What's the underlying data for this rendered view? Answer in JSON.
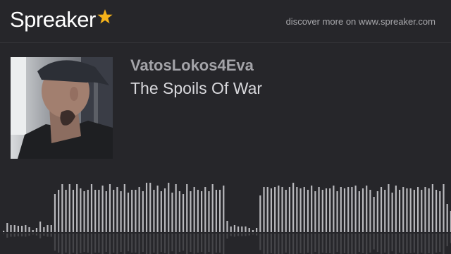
{
  "header": {
    "logo_text": "Spreaker",
    "logo_star_color": "#f5b21a",
    "discover_text": "discover more on www.spreaker.com"
  },
  "episode": {
    "cover_image": "artist photo: man in dark cap with neck tattoo",
    "artist": "VatosLokos4Eva",
    "title": "The Spoils Of War"
  },
  "waveform": {
    "bar_color": "#b9b9bd",
    "levels": [
      2,
      13,
      10,
      10,
      9,
      9,
      10,
      7,
      3,
      6,
      15,
      7,
      10,
      10,
      54,
      60,
      68,
      60,
      68,
      60,
      68,
      62,
      58,
      60,
      68,
      60,
      60,
      66,
      58,
      68,
      60,
      64,
      58,
      68,
      56,
      60,
      60,
      64,
      58,
      70,
      70,
      60,
      66,
      58,
      62,
      70,
      56,
      68,
      58,
      54,
      68,
      58,
      64,
      60,
      58,
      64,
      58,
      68,
      60,
      60,
      66,
      16,
      8,
      10,
      8,
      8,
      8,
      6,
      3,
      6,
      52,
      64,
      64,
      62,
      64,
      66,
      64,
      60,
      64,
      70,
      64,
      62,
      64,
      60,
      66,
      58,
      64,
      60,
      62,
      62,
      66,
      58,
      64,
      62,
      64,
      64,
      66,
      58,
      62,
      66,
      60,
      50,
      58,
      64,
      60,
      68,
      56,
      66,
      60,
      64,
      62,
      62,
      60,
      64,
      60,
      64,
      62,
      68,
      60,
      58,
      68,
      40,
      30
    ]
  }
}
